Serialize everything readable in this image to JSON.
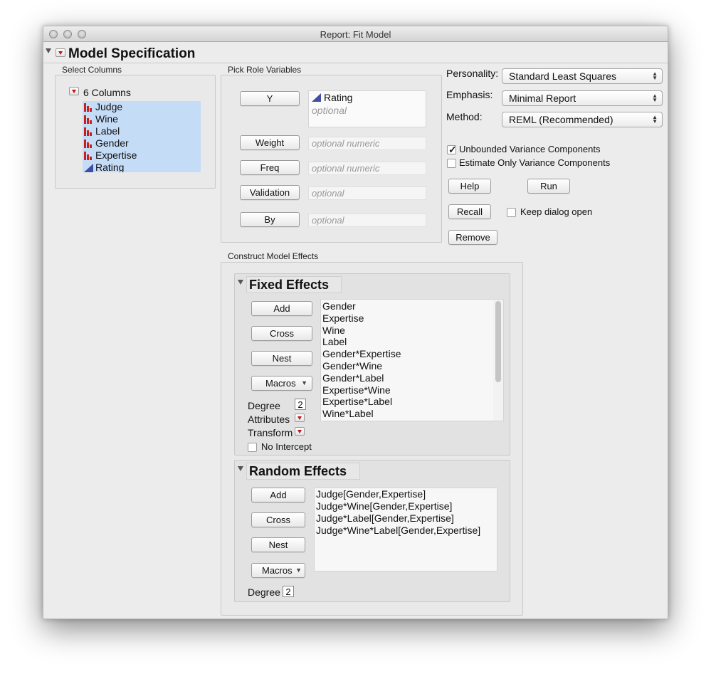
{
  "window": {
    "title": "Report: Fit Model"
  },
  "model_spec": {
    "title": "Model Specification"
  },
  "select_columns": {
    "label": "Select Columns",
    "count_label": "6 Columns",
    "columns": [
      {
        "name": "Judge",
        "type": "nominal-icon"
      },
      {
        "name": "Wine",
        "type": "nominal-icon"
      },
      {
        "name": "Label",
        "type": "nominal-icon"
      },
      {
        "name": "Gender",
        "type": "nominal-icon"
      },
      {
        "name": "Expertise",
        "type": "nominal-icon"
      },
      {
        "name": "Rating",
        "type": "continuous-icon"
      }
    ]
  },
  "roles": {
    "label": "Pick Role Variables",
    "y": {
      "button": "Y",
      "value": "Rating",
      "hint": "optional"
    },
    "weight": {
      "button": "Weight",
      "hint": "optional numeric"
    },
    "freq": {
      "button": "Freq",
      "hint": "optional numeric"
    },
    "validation": {
      "button": "Validation",
      "hint": "optional"
    },
    "by": {
      "button": "By",
      "hint": "optional"
    }
  },
  "options": {
    "personality_label": "Personality:",
    "personality_value": "Standard Least Squares",
    "emphasis_label": "Emphasis:",
    "emphasis_value": "Minimal Report",
    "method_label": "Method:",
    "method_value": "REML (Recommended)",
    "unbounded_label": "Unbounded Variance Components",
    "unbounded_checked": true,
    "estimate_only_label": "Estimate Only Variance Components",
    "estimate_only_checked": false,
    "help": "Help",
    "run": "Run",
    "recall": "Recall",
    "keep_open_label": "Keep dialog open",
    "remove": "Remove"
  },
  "construct": {
    "label": "Construct Model Effects",
    "fixed": {
      "title": "Fixed Effects",
      "add": "Add",
      "cross": "Cross",
      "nest": "Nest",
      "macros": "Macros",
      "degree_label": "Degree",
      "degree_value": "2",
      "attributes_label": "Attributes",
      "transform_label": "Transform",
      "no_intercept_label": "No Intercept",
      "effects": [
        "Gender",
        "Expertise",
        "Wine",
        "Label",
        "Gender*Expertise",
        "Gender*Wine",
        "Gender*Label",
        "Expertise*Wine",
        "Expertise*Label",
        "Wine*Label"
      ]
    },
    "random": {
      "title": "Random Effects",
      "add": "Add",
      "cross": "Cross",
      "nest": "Nest",
      "macros": "Macros",
      "degree_label": "Degree",
      "degree_value": "2",
      "effects": [
        "Judge[Gender,Expertise]",
        "Judge*Wine[Gender,Expertise]",
        "Judge*Label[Gender,Expertise]",
        "Judge*Wine*Label[Gender,Expertise]"
      ]
    }
  },
  "colors": {
    "selection": "#c5dcf7",
    "nominal": "#c62020",
    "continuous": "#3e4ea6",
    "menu_red": "#c41212"
  }
}
